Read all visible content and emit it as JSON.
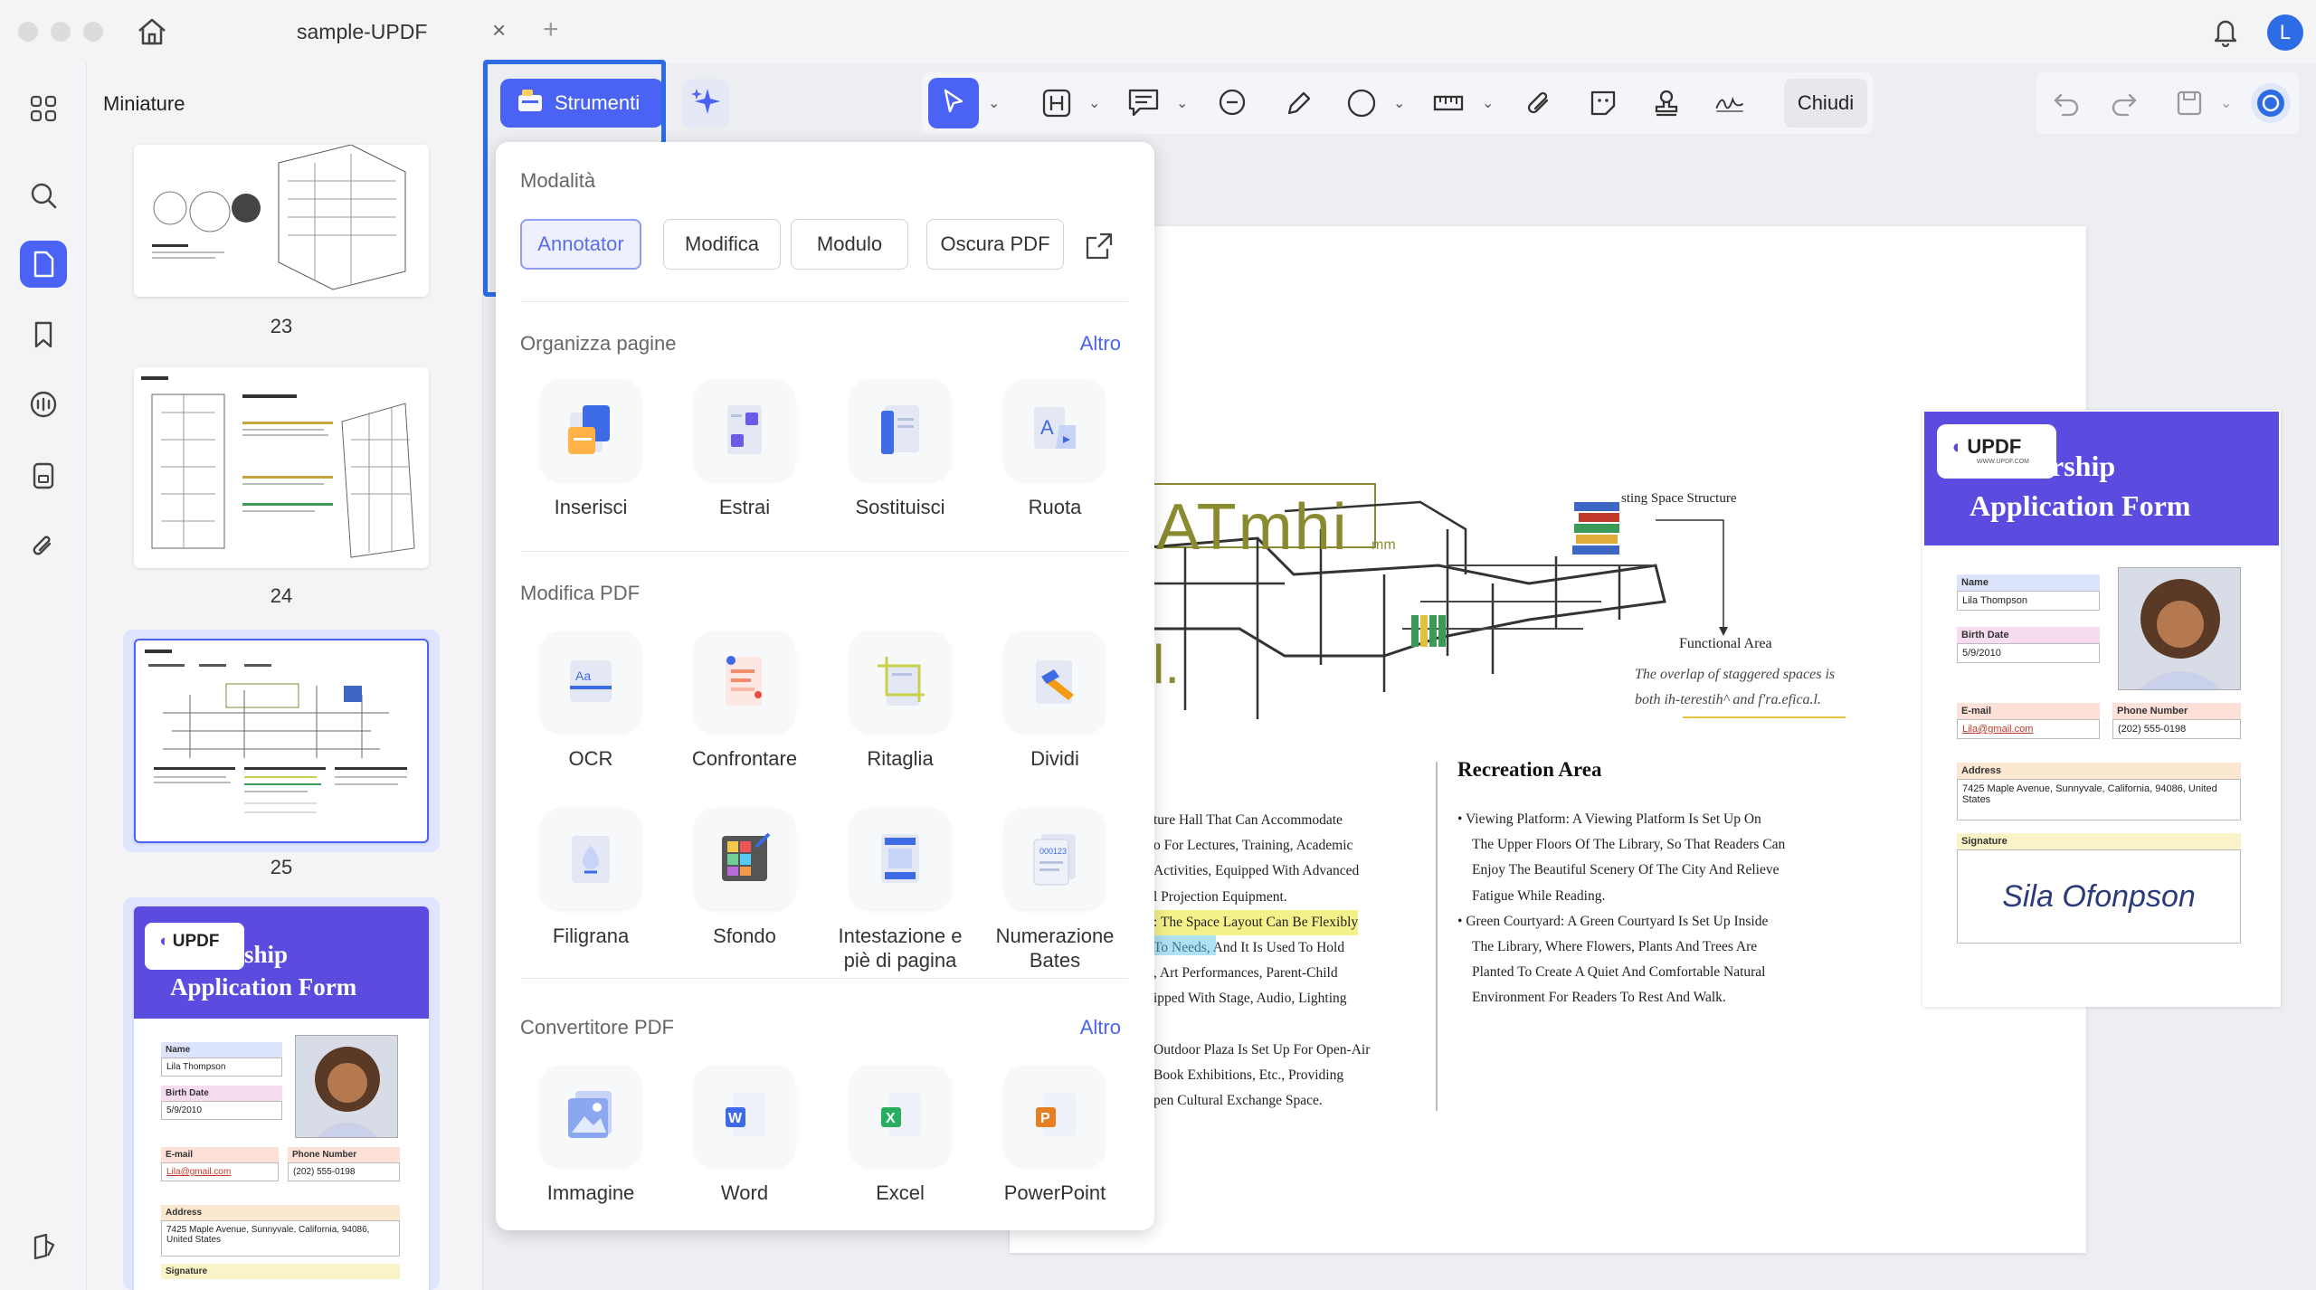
{
  "window": {
    "tab_title": "sample-UPDF",
    "tab_close": "×",
    "tab_add": "+",
    "avatar_letter": "L"
  },
  "sidebar": {
    "panel_title": "Miniature",
    "thumbnails": [
      {
        "page": "23"
      },
      {
        "page": "24"
      },
      {
        "page": "25"
      }
    ]
  },
  "toolbar": {
    "strumenti_label": "Strumenti",
    "chiudi_label": "Chiudi"
  },
  "tools_menu": {
    "mode_section": "Modalità",
    "modes": [
      {
        "label": "Annotator",
        "active": true
      },
      {
        "label": "Modifica",
        "active": false
      },
      {
        "label": "Modulo",
        "active": false
      },
      {
        "label": "Oscura PDF",
        "active": false
      }
    ],
    "organize": {
      "title": "Organizza pagine",
      "more": "Altro",
      "items": [
        {
          "label": "Inserisci",
          "icon": "insert-icon"
        },
        {
          "label": "Estrai",
          "icon": "extract-icon"
        },
        {
          "label": "Sostituisci",
          "icon": "replace-icon"
        },
        {
          "label": "Ruota",
          "icon": "rotate-icon"
        }
      ]
    },
    "edit_pdf": {
      "title": "Modifica PDF",
      "items": [
        {
          "label": "OCR",
          "icon": "ocr-icon"
        },
        {
          "label": "Confrontare",
          "icon": "compare-icon"
        },
        {
          "label": "Ritaglia",
          "icon": "crop-icon"
        },
        {
          "label": "Dividi",
          "icon": "split-icon"
        },
        {
          "label": "Filigrana",
          "icon": "watermark-icon"
        },
        {
          "label": "Sfondo",
          "icon": "background-icon"
        },
        {
          "label": "Intestazione e piè di pagina",
          "icon": "header-footer-icon"
        },
        {
          "label": "Numerazione Bates",
          "icon": "bates-icon"
        }
      ]
    },
    "converter": {
      "title": "Convertitore PDF",
      "more": "Altro",
      "items": [
        {
          "label": "Immagine",
          "icon": "image-icon"
        },
        {
          "label": "Word",
          "icon": "word-icon"
        },
        {
          "label": "Excel",
          "icon": "excel-icon"
        },
        {
          "label": "PowerPoint",
          "icon": "powerpoint-icon"
        }
      ]
    }
  },
  "document": {
    "drawing_title": "sting Space Structure",
    "atmhi_text": "ATmhi",
    "atmhi_unit": "mm",
    "large_l": "l.",
    "functional_area": "Functional Area",
    "overlap_line1": "The overlap of staggered spaces is",
    "overlap_line2": "both ih-terestih^ and f'ra.efica.l.",
    "left_lines": [
      "ture Hall That Can Accommodate",
      "o For Lectures, Training, Academic",
      "Activities, Equipped With Advanced",
      "l Projection Equipment.",
      ": The Space Layout Can Be Flexibly",
      "To Needs, And It Is Used To Hold",
      ", Art Performances, Parent-Child",
      "ipped With Stage, Audio, Lighting",
      "",
      "Outdoor Plaza Is Set Up For Open-Air",
      "Book Exhibitions, Etc., Providing",
      "pen Cultural Exchange Space."
    ],
    "recreation_title": "Recreation Area",
    "recreation_lines": [
      "Viewing Platform: A Viewing Platform Is Set Up On",
      "The Upper Floors Of The Library, So That Readers Can",
      "Enjoy The Beautiful Scenery Of The City And Relieve",
      "Fatigue While Reading.",
      "Green Courtyard: A Green Courtyard Is Set Up Inside",
      "The Library, Where Flowers, Plants And Trees Are",
      "Planted To Create A Quiet And Comfortable Natural",
      "Environment For Readers To Rest And Walk."
    ]
  },
  "form": {
    "brand": "UPDF",
    "brand_url": "WWW.UPDF.COM",
    "title_line1": "rship",
    "title_line2": "Application Form",
    "name_label": "Name",
    "name_value": "Lila Thompson",
    "birth_label": "Birth Date",
    "birth_value": "5/9/2010",
    "email_label": "E-mail",
    "email_value": "Lila@gmail.com",
    "phone_label": "Phone Number",
    "phone_value": "(202) 555-0198",
    "address_label": "Address",
    "address_value": "7425 Maple Avenue, Sunnyvale, California, 94086, United States",
    "signature_label": "Signature",
    "signature_value": "Sila Ofonpson"
  },
  "colors": {
    "accent": "#4a63f5",
    "form_purple": "#5b4ce0",
    "highlight_box": "#2e6be6"
  }
}
